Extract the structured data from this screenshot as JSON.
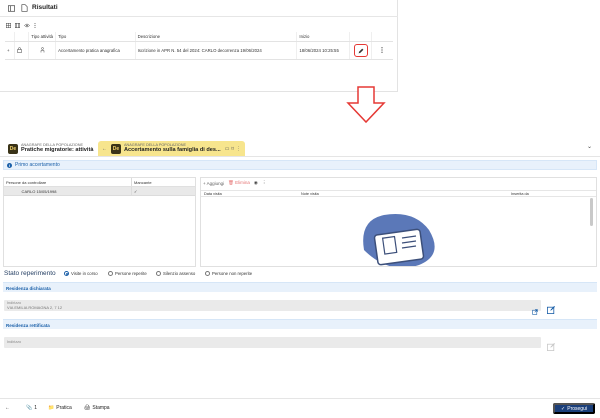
{
  "top": {
    "title": "Risultati",
    "table": {
      "headers": [
        "",
        "",
        "Tipo attività",
        "Tipo",
        "Descrizione",
        "Inizio",
        "",
        ""
      ],
      "row": {
        "tipo": "Accertamento pratica anagrafica",
        "descrizione": "Iscrizione in APR N. 54 del 2024:                CARLO decorrenza 19/06/2024",
        "inizio": "18/06/2024 10:25:55"
      }
    }
  },
  "tabs": [
    {
      "small": "ANAGRAFE DELLA POPOLAZIONE",
      "big": "Pratiche migratorie: attività"
    },
    {
      "small": "ANAGRAFE DELLA POPOLAZIONE",
      "big": "Accertamento sulla famiglia di des..."
    }
  ],
  "notice": {
    "label": "Primo accertamento"
  },
  "persons": {
    "headers": [
      "Persone da controllare",
      "Mancante"
    ],
    "rows": [
      {
        "name": "              CARLO 15/05/1998",
        "mancante": "✓"
      }
    ]
  },
  "visits": {
    "add_label": "Aggiungi",
    "delete_label": "Elimina",
    "headers": [
      "Data visita",
      "Note visita",
      "Inserita da"
    ]
  },
  "stato": {
    "title": "Stato reperimento",
    "options": [
      "Visite in corso",
      "Persone reperite",
      "Silenzio assenso",
      "Persone non reperite"
    ],
    "selected": "Visite in corso"
  },
  "residenza_dichiarata": {
    "title": "Residenza dichiarata",
    "field_label": "Indirizzo",
    "field_value": "VIA EMILIA ROMAGNA 2, 7 12"
  },
  "residenza_rettificata": {
    "title": "Residenza rettificata",
    "field_label": "Indirizzo"
  },
  "bottom": {
    "count": "1",
    "pratica": "Pratica",
    "stampa": "Stampa",
    "proceed": "Prosegui"
  },
  "colors": {
    "accent": "#1a5fa8",
    "primary_button": "#1b3f7a",
    "highlight": "#e53935",
    "tab_active": "#f7e58d"
  }
}
